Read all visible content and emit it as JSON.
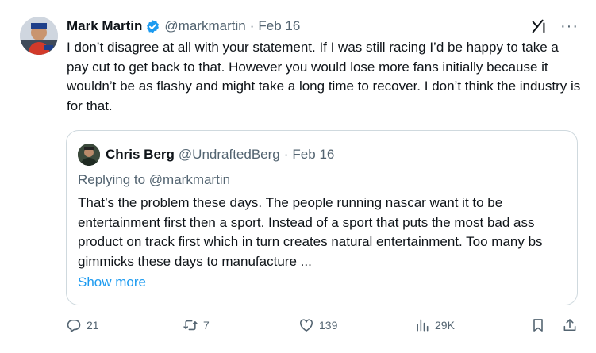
{
  "tweet": {
    "author_name": "Mark Martin",
    "handle": "@markmartin",
    "separator": "·",
    "date": "Feb 16",
    "text": "I don’t disagree at all with your statement. If I was still racing I’d be happy to take a pay cut to get back to that. However you would lose more fans initially because it wouldn’t be as flashy and might take a long time to recover. I don’t think the industry is for that.",
    "more_icon_text": "···"
  },
  "quote": {
    "author_name": "Chris Berg",
    "handle": "@UndraftedBerg",
    "separator": "·",
    "date": "Feb 16",
    "replying_prefix": "Replying to ",
    "replying_handle": "@markmartin",
    "text": "That’s the problem these days. The people running nascar want it to be entertainment first then a sport. Instead of a sport that puts the most bad ass product on track first which in turn creates natural entertainment. Too many bs gimmicks these days to manufacture ...",
    "show_more": "Show more"
  },
  "actions": {
    "replies": "21",
    "reposts": "7",
    "likes": "139",
    "views": "29K"
  },
  "colors": {
    "accent": "#1d9bf0",
    "muted": "#536471",
    "border": "#cfd9de",
    "text": "#0f1419"
  },
  "icons": [
    "verified-badge-icon",
    "grok-icon",
    "more-icon",
    "reply-icon",
    "repost-icon",
    "like-icon",
    "views-icon",
    "bookmark-icon",
    "share-icon"
  ]
}
